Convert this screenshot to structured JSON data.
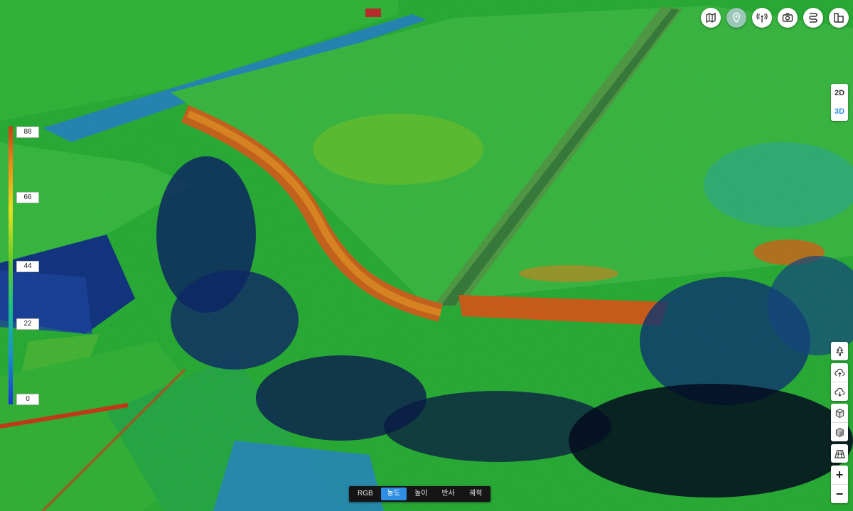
{
  "viewer": {
    "view_modes": [
      {
        "label": "2D",
        "active": false
      },
      {
        "label": "3D",
        "active": true
      }
    ],
    "top_tools": [
      {
        "icon": "map-icon",
        "active": false
      },
      {
        "icon": "location-pin-icon",
        "active": true
      },
      {
        "icon": "antenna-icon",
        "active": false
      },
      {
        "icon": "camera-icon",
        "active": false
      },
      {
        "icon": "route-icon",
        "active": false
      },
      {
        "icon": "building-icon",
        "active": false
      }
    ],
    "side_tools": [
      "tree-icon",
      "cloud-upload-icon",
      "cloud-download-icon",
      "cube-outline-icon",
      "cube-solid-icon",
      "grid-plane-icon"
    ],
    "zoom": {
      "in_label": "+",
      "out_label": "−"
    }
  },
  "legend": {
    "ticks": [
      "88",
      "66",
      "44",
      "22",
      "0"
    ]
  },
  "color_modes": [
    {
      "label": "RGB",
      "active": false
    },
    {
      "label": "농도",
      "active": true
    },
    {
      "label": "높이",
      "active": false
    },
    {
      "label": "반사",
      "active": false
    },
    {
      "label": "궤적",
      "active": false
    }
  ],
  "colors": {
    "accent": "#2f8de4",
    "high": "#d23a12",
    "mid": "#5ec82a",
    "low": "#1b35d8"
  }
}
